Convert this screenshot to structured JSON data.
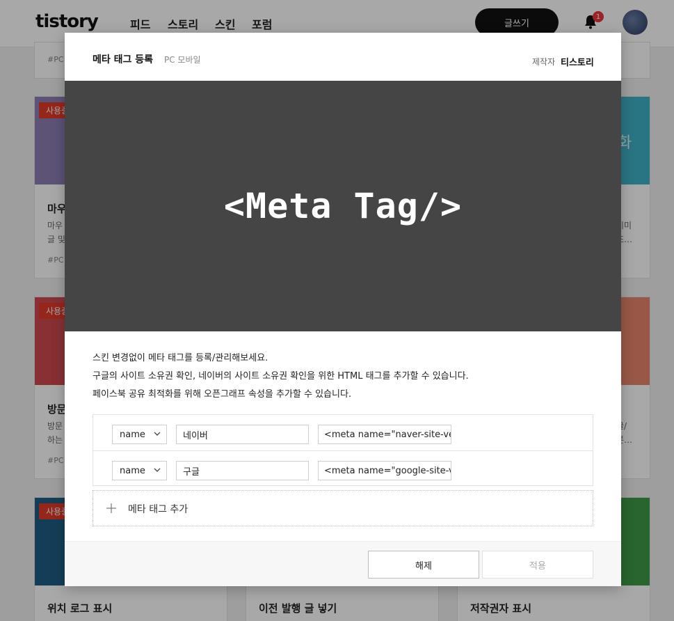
{
  "header": {
    "logo": "tistory",
    "nav": [
      "피드",
      "스토리",
      "스킨",
      "포럼"
    ],
    "write_label": "글쓰기",
    "notification_count": "1"
  },
  "background_cards": [
    {
      "badge": "",
      "title": "",
      "desc": [
        "",
        ""
      ],
      "tag": "#PC"
    },
    {
      "badge": "사용중",
      "title": "마우",
      "desc": [
        "마우",
        "글 및"
      ],
      "tag": "#PC",
      "color": "#8e7fb5"
    },
    {
      "badge": "",
      "title": "",
      "desc": [
        "이미",
        "조…"
      ],
      "tag": "",
      "color": "#3fb2c7",
      "img_text": "화"
    },
    {
      "badge": "사용중",
      "title": "방문",
      "desc": [
        "방문",
        "하는"
      ],
      "tag": "#PC",
      "color": "#cf4a50"
    },
    {
      "badge": "",
      "title": "",
      "desc": [
        "글/",
        "른…"
      ],
      "tag": "",
      "color": "#e8866c"
    },
    {
      "badge": "사용중",
      "title": "",
      "desc": [],
      "tag": "",
      "color": "#1f5e86"
    },
    {
      "badge": "",
      "title": "",
      "desc": [],
      "tag": "",
      "color": "#3f9a48"
    },
    {
      "title": "위치 로그 표시"
    },
    {
      "title": "이전 발행 글 넣기"
    },
    {
      "title": "저작권자 표시"
    }
  ],
  "modal": {
    "title": "메타 태그 등록",
    "subtitle": "PC 모바일",
    "maker_label": "제작자",
    "maker_name": "티스토리",
    "hero_text": "<Meta Tag/>",
    "description": [
      "스킨 변경없이 메타 태그를 등록/관리해보세요.",
      "구글의 사이트 소유권 확인, 네이버의 사이트 소유권 확인을 위한 HTML 태그를 추가할 수 있습니다.",
      "페이스북 공유 최적화를 위해 오픈그래프 속성을 추가할 수 있습니다."
    ],
    "rows": [
      {
        "type": "name",
        "name": "네이버",
        "value": "<meta name=\"naver-site-ver"
      },
      {
        "type": "name",
        "name": "구글",
        "value": "<meta name=\"google-site-ve"
      }
    ],
    "add_label": "메타 태그 추가",
    "cancel_label": "해제",
    "apply_label": "적용"
  }
}
